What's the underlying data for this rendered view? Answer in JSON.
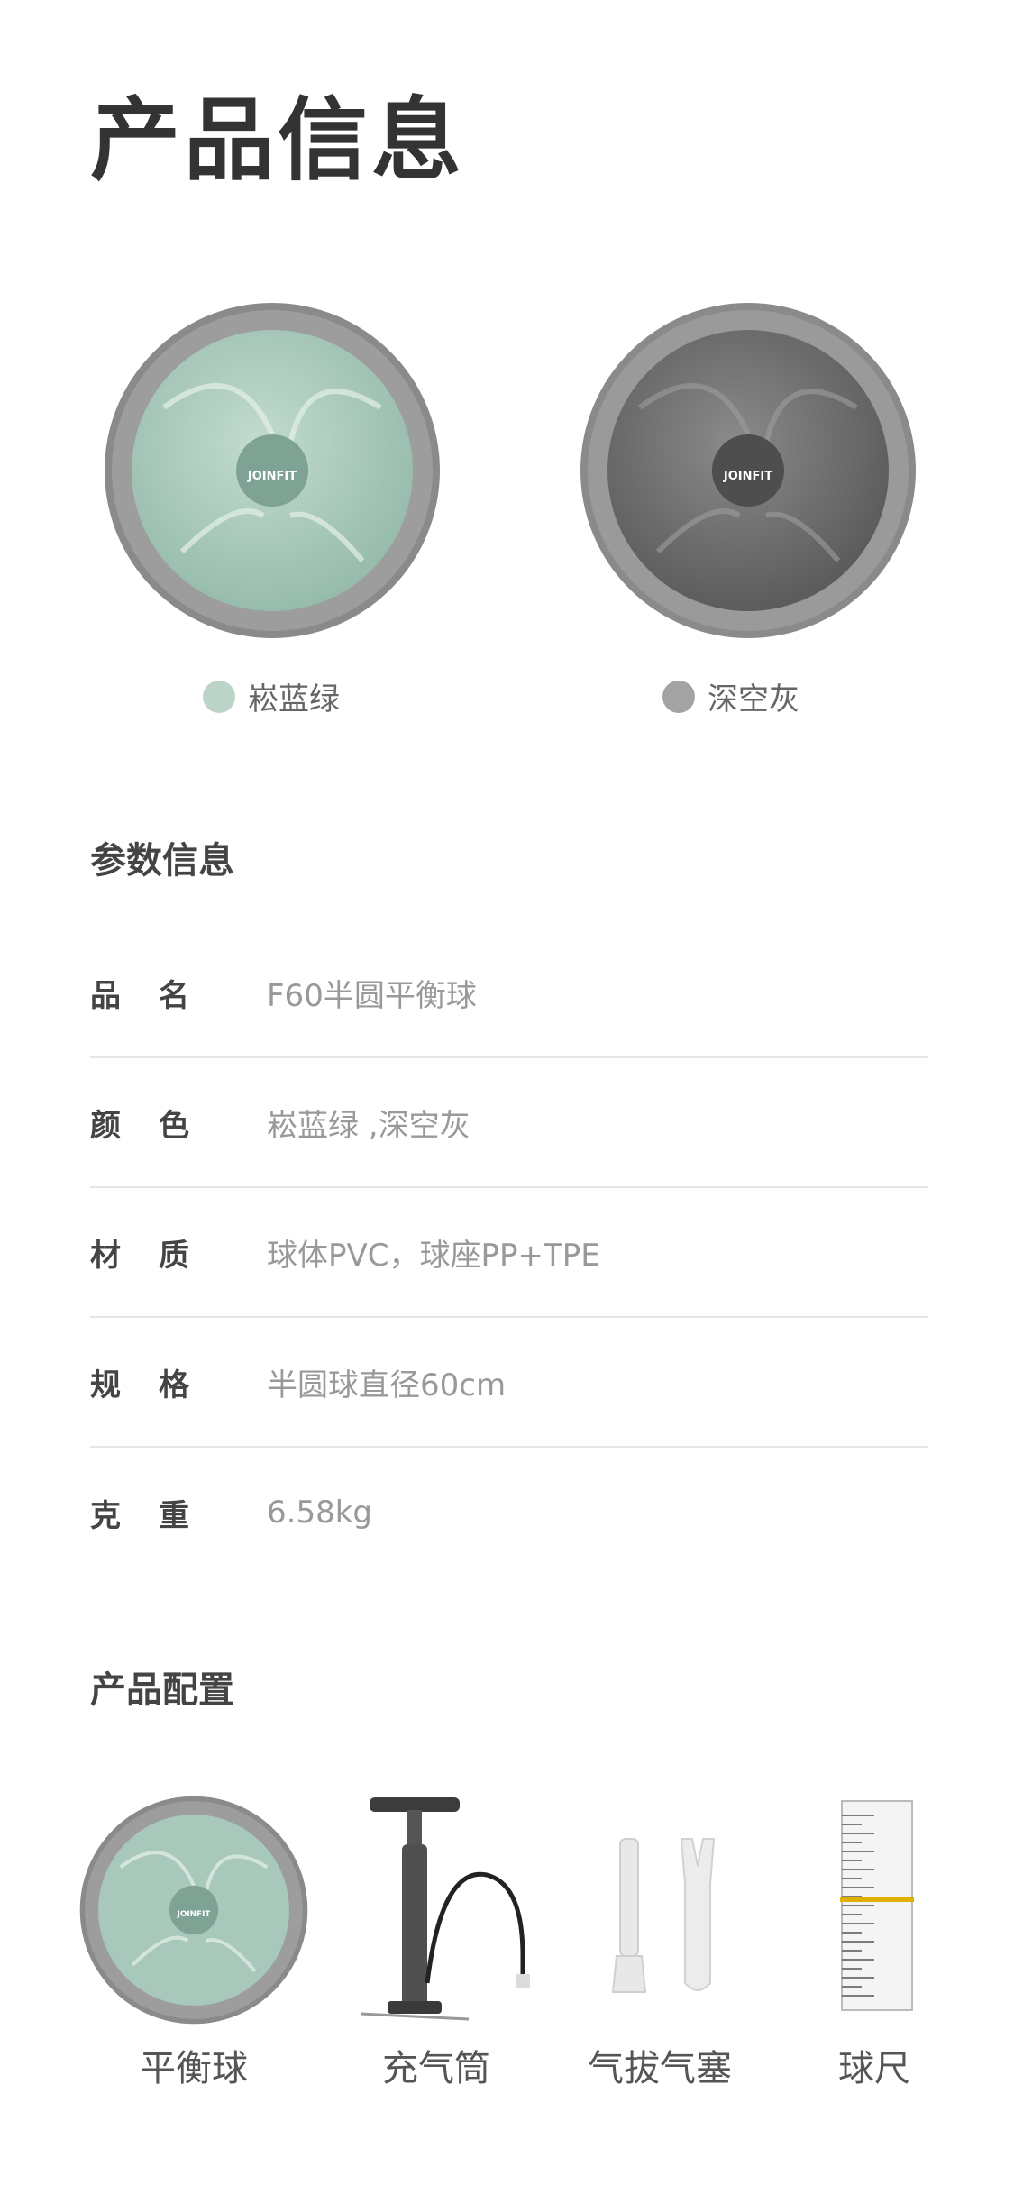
{
  "title": "产品信息",
  "colors": [
    {
      "label": "崧蓝绿",
      "dot": "#bcd4c8",
      "ball_color": "#a7c8bb"
    },
    {
      "label": "深空灰",
      "dot": "#a3a3a3",
      "ball_color": "#6e6e6e"
    }
  ],
  "logo_text": "JOINFIT",
  "params": {
    "title": "参数信息",
    "rows": [
      {
        "key": "品　名",
        "value": "F60半圆平衡球"
      },
      {
        "key": "颜　色",
        "value": "崧蓝绿 ,深空灰"
      },
      {
        "key": "材　质",
        "value": "球体PVC，球座PP+TPE"
      },
      {
        "key": "规　格",
        "value": "半圆球直径60cm"
      },
      {
        "key": "克　重",
        "value": "6.58kg"
      }
    ]
  },
  "config": {
    "title": "产品配置",
    "items": [
      {
        "label": "平衡球",
        "icon": "balance-ball-icon"
      },
      {
        "label": "充气筒",
        "icon": "pump-icon"
      },
      {
        "label": "气拔气塞",
        "icon": "plug-and-remover-icon"
      },
      {
        "label": "球尺",
        "icon": "ruler-icon"
      }
    ]
  }
}
